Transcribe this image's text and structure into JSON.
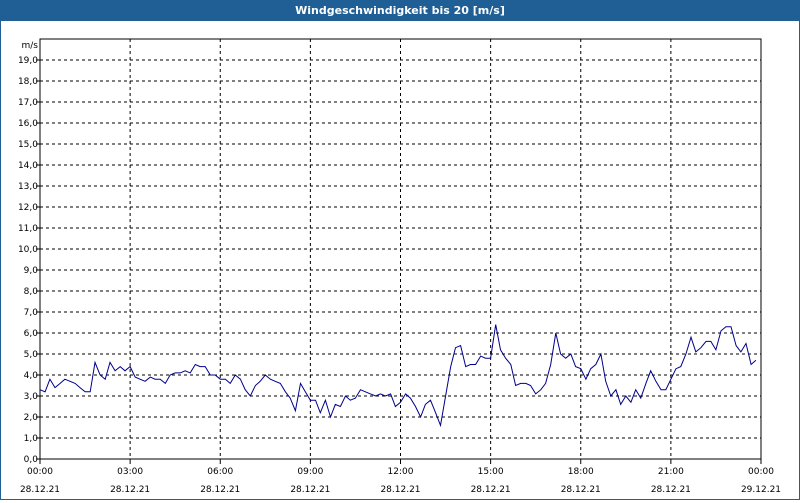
{
  "window": {
    "title": "Windgeschwindigkeit bis 20 [m/s]"
  },
  "chart_data": {
    "type": "line",
    "title": "Windgeschwindigkeit bis 20 [m/s]",
    "ylabel": "m/s",
    "xlabel": "",
    "ylim": [
      0,
      20
    ],
    "yticks": [
      "0,0",
      "1,0",
      "2,0",
      "3,0",
      "4,0",
      "5,0",
      "6,0",
      "7,0",
      "8,0",
      "9,0",
      "10,0",
      "11,0",
      "12,0",
      "13,0",
      "14,0",
      "15,0",
      "16,0",
      "17,0",
      "18,0",
      "19,0"
    ],
    "xlim_hours": [
      0,
      24
    ],
    "xticks": [
      {
        "time": "00:00",
        "date": "28.12.21"
      },
      {
        "time": "03:00",
        "date": "28.12.21"
      },
      {
        "time": "06:00",
        "date": "28.12.21"
      },
      {
        "time": "09:00",
        "date": "28.12.21"
      },
      {
        "time": "12:00",
        "date": "28.12.21"
      },
      {
        "time": "15:00",
        "date": "28.12.21"
      },
      {
        "time": "18:00",
        "date": "28.12.21"
      },
      {
        "time": "21:00",
        "date": "28.12.21"
      },
      {
        "time": "00:00",
        "date": "29.12.21"
      }
    ],
    "grid": true,
    "line_color": "#00008b",
    "series": [
      {
        "x_hours": [
          0,
          0.17,
          0.33,
          0.5,
          0.67,
          0.83,
          1,
          1.17,
          1.33,
          1.5,
          1.67,
          1.83,
          2,
          2.17,
          2.33,
          2.5,
          2.67,
          2.83,
          3,
          3.17,
          3.33,
          3.5,
          3.67,
          3.83,
          4,
          4.17,
          4.33,
          4.5,
          4.67,
          4.83,
          5,
          5.17,
          5.33,
          5.5,
          5.67,
          5.83,
          6,
          6.17,
          6.33,
          6.5,
          6.67,
          6.83,
          7,
          7.17,
          7.33,
          7.5,
          7.67,
          7.83,
          8,
          8.17,
          8.33,
          8.5,
          8.67,
          8.83,
          9,
          9.17,
          9.33,
          9.5,
          9.67,
          9.83,
          10,
          10.17,
          10.33,
          10.5,
          10.67,
          10.83,
          11,
          11.17,
          11.33,
          11.5,
          11.67,
          11.83,
          12,
          12.17,
          12.33,
          12.5,
          12.67,
          12.83,
          13,
          13.17,
          13.33,
          13.5,
          13.67,
          13.83,
          14,
          14.17,
          14.33,
          14.5,
          14.67,
          14.83,
          15,
          15.17,
          15.33,
          15.5,
          15.67,
          15.83,
          16,
          16.17,
          16.33,
          16.5,
          16.67,
          16.83,
          17,
          17.17,
          17.33,
          17.5,
          17.67,
          17.83,
          18,
          18.17,
          18.33,
          18.5,
          18.67,
          18.83,
          19,
          19.17,
          19.33,
          19.5,
          19.67,
          19.83,
          20,
          20.17,
          20.33,
          20.5,
          20.67,
          20.83,
          21,
          21.17,
          21.33,
          21.5,
          21.67,
          21.83,
          22,
          22.17,
          22.33,
          22.5,
          22.67,
          22.83,
          23,
          23.17,
          23.33,
          23.5,
          23.67,
          23.83
        ],
        "values": [
          3.3,
          3.2,
          3.8,
          3.4,
          3.6,
          3.8,
          3.7,
          3.6,
          3.4,
          3.2,
          3.2,
          4.6,
          4.0,
          3.8,
          4.6,
          4.2,
          4.4,
          4.2,
          4.4,
          3.9,
          3.8,
          3.7,
          3.9,
          3.8,
          3.8,
          3.6,
          4.0,
          4.1,
          4.1,
          4.2,
          4.1,
          4.5,
          4.4,
          4.4,
          4.0,
          4.0,
          3.8,
          3.8,
          3.6,
          4.0,
          3.8,
          3.3,
          3.0,
          3.5,
          3.7,
          4.0,
          3.8,
          3.7,
          3.6,
          3.2,
          2.9,
          2.3,
          3.6,
          3.2,
          2.8,
          2.8,
          2.2,
          2.8,
          2.0,
          2.6,
          2.5,
          3.0,
          2.8,
          2.9,
          3.3,
          3.2,
          3.1,
          3.0,
          3.1,
          3.0,
          3.1,
          2.5,
          2.7,
          3.1,
          2.9,
          2.5,
          2.0,
          2.6,
          2.8,
          2.2,
          1.6,
          3.0,
          4.4,
          5.3,
          5.4,
          4.4,
          4.5,
          4.5,
          4.9,
          4.8,
          4.8,
          6.4,
          5.2,
          4.8,
          4.5,
          3.5,
          3.6,
          3.6,
          3.5,
          3.1,
          3.3,
          3.6,
          4.5,
          6.0,
          5.0,
          4.8,
          5.0,
          4.4,
          4.3,
          3.8,
          4.3,
          4.5,
          5.0,
          3.7,
          3.0,
          3.3,
          2.6,
          3.0,
          2.7,
          3.3,
          2.9,
          3.6,
          4.2,
          3.7,
          3.3,
          3.3,
          3.8,
          4.3,
          4.4,
          5.0,
          5.8,
          5.1,
          5.3,
          5.6,
          5.6,
          5.2,
          6.1,
          6.3,
          6.3,
          5.4,
          5.1,
          5.5,
          4.5,
          4.7
        ]
      }
    ]
  }
}
